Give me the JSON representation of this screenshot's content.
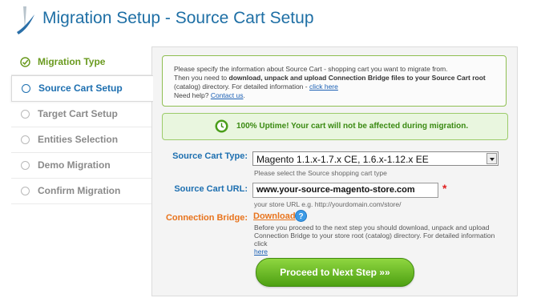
{
  "header": {
    "title": "Migration Setup - Source Cart Setup"
  },
  "sidebar": {
    "steps": [
      {
        "label": "Migration Type",
        "state": "done"
      },
      {
        "label": "Source Cart Setup",
        "state": "active"
      },
      {
        "label": "Target Cart Setup",
        "state": "pending"
      },
      {
        "label": "Entities Selection",
        "state": "pending"
      },
      {
        "label": "Demo Migration",
        "state": "pending"
      },
      {
        "label": "Confirm Migration",
        "state": "pending"
      }
    ]
  },
  "info": {
    "line1": "Please specify the information about Source Cart - shopping cart you want to migrate from.",
    "line2_prefix": "Then you need to ",
    "line2_bold": "download, unpack and upload Connection Bridge files to your Source Cart root",
    "line3_prefix": "(catalog) directory. For detailed information - ",
    "line3_link": "click here",
    "line4_prefix": "Need help? ",
    "line4_link": "Contact us",
    "line4_suffix": "."
  },
  "uptime": {
    "text": "100% Uptime! Your cart will not be affected during migration."
  },
  "form": {
    "source_type_label": "Source Cart Type:",
    "source_type_value": "Magento 1.1.x-1.7.x CE, 1.6.x-1.12.x EE",
    "source_type_hint": "Please select the Source shopping cart type",
    "source_url_label": "Source Cart URL:",
    "source_url_value": "www.your-source-magento-store.com",
    "source_url_hint": "your store URL e.g. http://yourdomain.com/store/",
    "required_mark": "*",
    "bridge_label": "Connection Bridge:",
    "bridge_download": "Download",
    "help_glyph": "?",
    "bridge_text": "Before you proceed to the next step you should download, unpack and upload Connection Bridge to your store root (catalog) directory. For detailed information click",
    "bridge_link": "here"
  },
  "proceed_button": {
    "label": "Proceed to Next Step »»"
  },
  "colors": {
    "accent": "#1d6fb0",
    "success": "#6a9a1f",
    "orange": "#e8731c",
    "button": "#5aae19"
  }
}
